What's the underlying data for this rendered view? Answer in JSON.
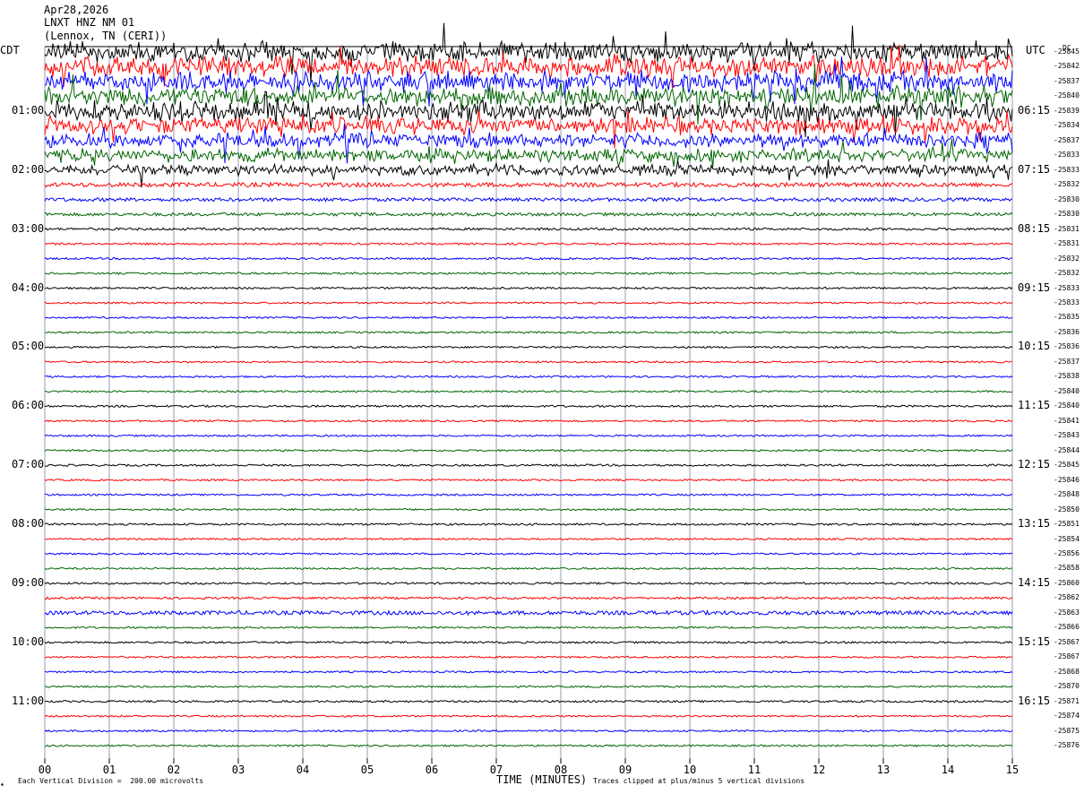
{
  "header": {
    "date": "Apr28,2026",
    "station": "LNXT HNZ NM 01",
    "location": "(Lennox, TN (CERI))"
  },
  "left_zone": "CDT",
  "right_zone": "UTC",
  "dc_label": "DC",
  "footer": {
    "scale_note": "Each Vertical Division =  200.00 microvolts",
    "xlabel": "TIME (MINUTES)",
    "clip_note": "Traces clipped at plus/minus 5 vertical divisions"
  },
  "colors": {
    "trace_cycle": [
      "#000000",
      "#ff0000",
      "#0000ff",
      "#006400"
    ],
    "grid": "#8080a0"
  },
  "chart_data": {
    "type": "line",
    "title": "LNXT HNZ NM 01",
    "xlabel": "TIME (MINUTES)",
    "xlim": [
      0,
      15
    ],
    "x_ticks": [
      "00",
      "01",
      "02",
      "03",
      "04",
      "05",
      "06",
      "07",
      "08",
      "09",
      "10",
      "11",
      "12",
      "13",
      "14",
      "15"
    ],
    "left_time_labels": [
      "01:00",
      "02:00",
      "03:00",
      "04:00",
      "05:00",
      "06:00",
      "07:00",
      "08:00",
      "09:00",
      "10:00",
      "11:00"
    ],
    "right_time_labels": [
      "06:15",
      "07:15",
      "08:15",
      "09:15",
      "10:15",
      "11:15",
      "12:15",
      "13:15",
      "14:15",
      "15:15",
      "16:15"
    ],
    "dc_offsets": [
      -25845,
      -25842,
      -25837,
      -25840,
      -25839,
      -25834,
      -25837,
      -25833,
      -25833,
      -25832,
      -25830,
      -25830,
      -25831,
      -25831,
      -25832,
      -25832,
      -25833,
      -25833,
      -25835,
      -25836,
      -25836,
      -25837,
      -25838,
      -25840,
      -25840,
      -25841,
      -25843,
      -25844,
      -25845,
      -25846,
      -25848,
      -25850,
      -25851,
      -25854,
      -25856,
      -25858,
      -25860,
      -25862,
      -25863,
      -25866,
      -25867,
      -25867,
      -25868,
      -25870,
      -25871,
      -25874,
      -25875,
      -25876
    ],
    "trace_activity": [
      3,
      3,
      3,
      3,
      3,
      2.6,
      2.2,
      2,
      1.6,
      1.1,
      0.9,
      0.8,
      0.6,
      0.5,
      0.5,
      0.5,
      0.5,
      0.45,
      0.45,
      0.45,
      0.45,
      0.45,
      0.45,
      0.45,
      0.5,
      0.45,
      0.45,
      0.45,
      0.5,
      0.45,
      0.45,
      0.45,
      0.5,
      0.45,
      0.45,
      0.45,
      0.5,
      0.55,
      1.0,
      0.45,
      0.5,
      0.45,
      0.45,
      0.45,
      0.5,
      0.45,
      0.45,
      0.45
    ]
  }
}
